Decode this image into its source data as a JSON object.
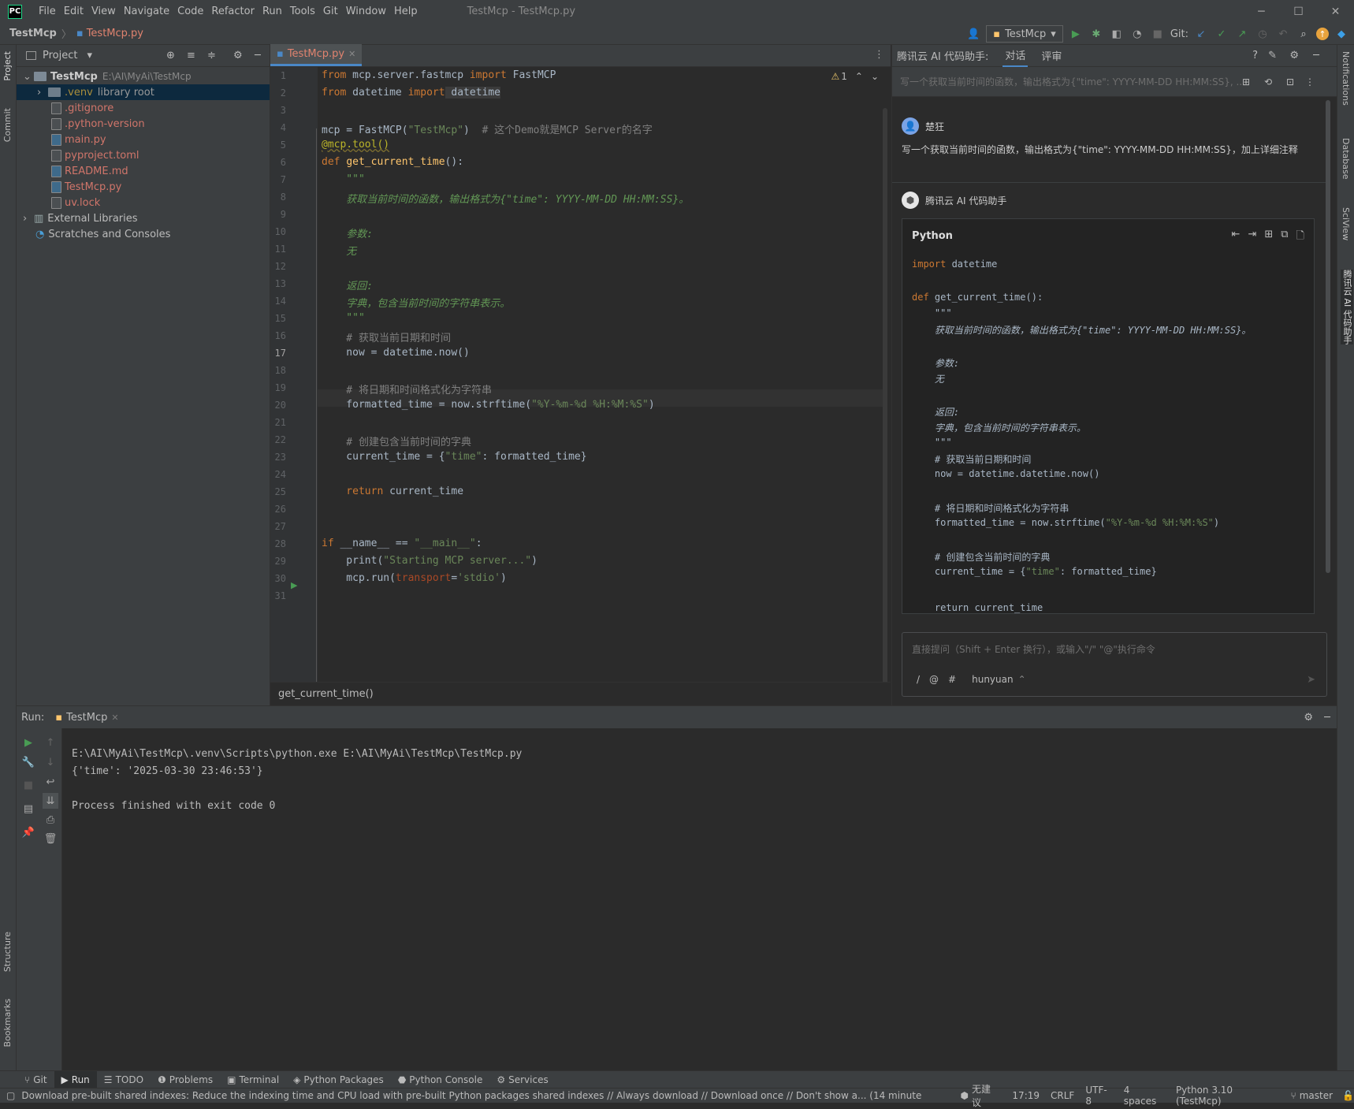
{
  "window": {
    "title": "TestMcp - TestMcp.py",
    "logo": "PC"
  },
  "menu": [
    "File",
    "Edit",
    "View",
    "Navigate",
    "Code",
    "Refactor",
    "Run",
    "Tools",
    "Git",
    "Window",
    "Help"
  ],
  "breadcrumb": {
    "project": "TestMcp",
    "file": "TestMcp.py"
  },
  "toolbar": {
    "run_config": "TestMcp",
    "git_label": "Git:"
  },
  "left_strip": {
    "project": "Project",
    "commit": "Commit",
    "structure": "Structure",
    "bookmarks": "Bookmarks"
  },
  "right_strip": {
    "notifications": "Notifications",
    "database": "Database",
    "sciview": "SciView",
    "ai": "腾讯云 AI 代码助手"
  },
  "project_panel": {
    "title": "Project",
    "root": {
      "name": "TestMcp",
      "path": "E:\\AI\\MyAi\\TestMcp"
    },
    "venv": {
      "name": ".venv",
      "suffix": "library root"
    },
    "files": [
      ".gitignore",
      ".python-version",
      "main.py",
      "pyproject.toml",
      "README.md",
      "TestMcp.py",
      "uv.lock"
    ],
    "external": "External Libraries",
    "scratches": "Scratches and Consoles"
  },
  "editor": {
    "tab": "TestMcp.py",
    "warnings": "1",
    "footer": "get_current_time()",
    "line_numbers": [
      "1",
      "2",
      "3",
      "4",
      "5",
      "6",
      "7",
      "8",
      "9",
      "10",
      "11",
      "12",
      "13",
      "14",
      "15",
      "16",
      "17",
      "18",
      "19",
      "20",
      "21",
      "22",
      "23",
      "24",
      "25",
      "26",
      "27",
      "28",
      "29",
      "30",
      "31"
    ],
    "code": {
      "l1a": "from",
      "l1b": " mcp.server.fastmcp ",
      "l1c": "import",
      "l1d": " FastMCP",
      "l2a": "from",
      "l2b": " datetime ",
      "l2c": "import",
      "l2d": " datetime",
      "l4a": "mcp = FastMCP(",
      "l4b": "\"TestMcp\"",
      "l4c": ")  ",
      "l4d": "# 这个Demo就是MCP Server的名字",
      "l5": "@mcp.tool()",
      "l6a": "def ",
      "l6b": "get_current_time",
      "l6c": "():",
      "l7": "    \"\"\"",
      "l8": "    获取当前时间的函数，输出格式为{\"time\": YYYY-MM-DD HH:MM:SS}。",
      "l10": "    参数:",
      "l11": "    无",
      "l13": "    返回:",
      "l14": "    字典，包含当前时间的字符串表示。",
      "l15": "    \"\"\"",
      "l16": "    # 获取当前日期和时间",
      "l17": "    now = datetime.now()",
      "l19": "    # 将日期和时间格式化为字符串",
      "l20a": "    formatted_time = now.strftime(",
      "l20b": "\"%Y-%m-%d %H:%M:%S\"",
      "l20c": ")",
      "l22": "    # 创建包含当前时间的字典",
      "l23a": "    current_time = {",
      "l23b": "\"time\"",
      "l23c": ": formatted_time}",
      "l25a": "    return",
      "l25b": " current_time",
      "l28a": "if",
      "l28b": " __name__ == ",
      "l28c": "\"__main__\"",
      "l28d": ":",
      "l29a": "    print(",
      "l29b": "\"Starting MCP server...\"",
      "l29c": ")",
      "l30a": "    mcp.run(",
      "l30b": "transport",
      "l30c": "=",
      "l30d": "'stdio'",
      "l30e": ")"
    }
  },
  "ai_panel": {
    "title": "腾讯云 AI 代码助手:",
    "tabs": [
      "对话",
      "评审"
    ],
    "history_query": "写一个获取当前时间的函数，输出格式为{\"time\": YYYY-MM-DD HH:MM:SS}, ...",
    "user_name": "楚狂",
    "user_message": "写一个获取当前时间的函数，输出格式为{\"time\": YYYY-MM-DD HH:MM:SS}，加上详细注释",
    "assistant_name": "腾讯云 AI 代码助手",
    "code_lang": "Python",
    "code": {
      "c1a": "import",
      "c1b": " datetime",
      "c2a": "def ",
      "c2b": "get_current_time():",
      "c3": "    \"\"\"",
      "c4": "    获取当前时间的函数，输出格式为{\"time\": YYYY-MM-DD HH:MM:SS}。",
      "c5": "    参数:",
      "c6": "    无",
      "c7": "    返回:",
      "c8": "    字典，包含当前时间的字符串表示。",
      "c9": "    \"\"\"",
      "c10": "    # 获取当前日期和时间",
      "c11": "    now = datetime.datetime.now()",
      "c12": "    # 将日期和时间格式化为字符串",
      "c13a": "    formatted_time = now.strftime(",
      "c13b": "\"%Y-%m-%d %H:%M:%S\"",
      "c13c": ")",
      "c14": "    # 创建包含当前时间的字典",
      "c15a": "    current_time = {",
      "c15b": "\"time\"",
      "c15c": ": formatted_time}",
      "c16": "    return current_time"
    },
    "input_placeholder": "直接提问（Shift + Enter 换行），或输入\"/\" \"@\"执行命令",
    "input_cmds": {
      "slash": "/",
      "at": "@",
      "hash": "#"
    },
    "model": "hunyuan"
  },
  "run_panel": {
    "label": "Run:",
    "tab": "TestMcp",
    "output": [
      "E:\\AI\\MyAi\\TestMcp\\.venv\\Scripts\\python.exe E:\\AI\\MyAi\\TestMcp\\TestMcp.py",
      "{'time': '2025-03-30 23:46:53'}",
      "",
      "Process finished with exit code 0"
    ]
  },
  "bottom_tabs": [
    "Git",
    "Run",
    "TODO",
    "Problems",
    "Terminal",
    "Python Packages",
    "Python Console",
    "Services"
  ],
  "status": {
    "message": "Download pre-built shared indexes: Reduce the indexing time and CPU load with pre-built Python packages shared indexes // Always download // Download once // Don't show a... (14 minutes ago)",
    "ai_status": "无建议",
    "position": "17:19",
    "line_sep": "CRLF",
    "encoding": "UTF-8",
    "indent": "4 spaces",
    "interpreter": "Python 3.10 (TestMcp)",
    "branch": "master"
  },
  "colors": {
    "accent": "#4a88c7",
    "modified_file": "#e0836f",
    "keyword": "#cc7832",
    "string": "#6a8759",
    "docstring": "#629755"
  }
}
